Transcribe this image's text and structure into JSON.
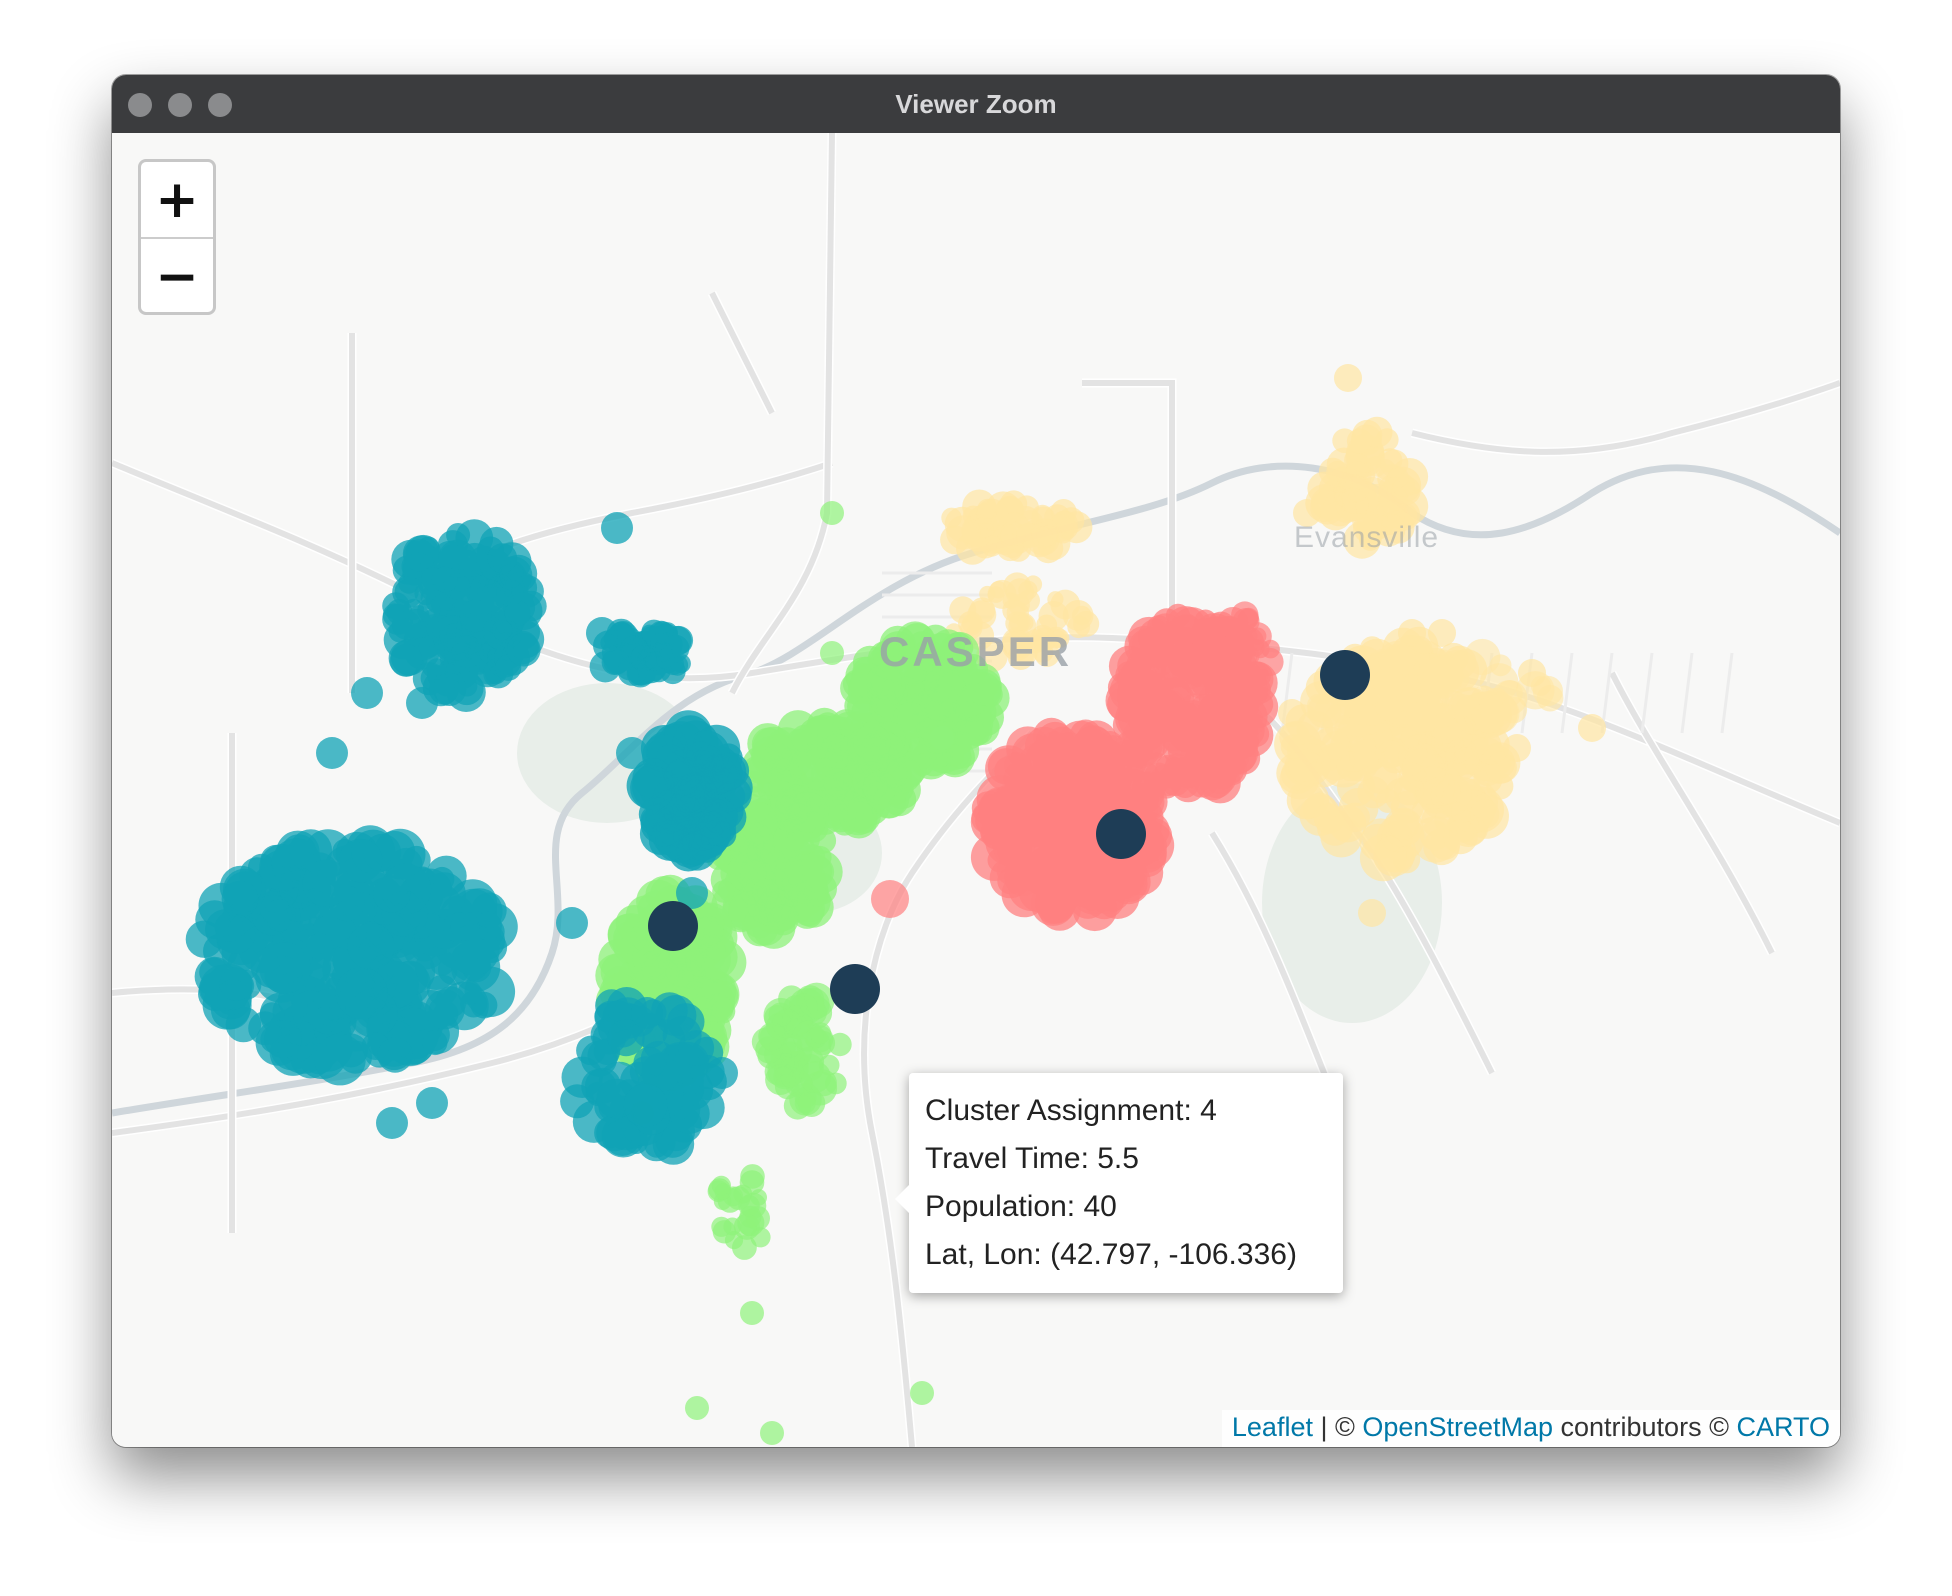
{
  "window": {
    "title": "Viewer Zoom"
  },
  "zoom": {
    "in_label": "+",
    "out_label": "−"
  },
  "places": [
    {
      "name": "CASPER"
    },
    {
      "name": "Evansville"
    }
  ],
  "tooltip": {
    "lines": [
      "Cluster Assignment: 4",
      "Travel Time: 5.5",
      "Population: 40",
      "Lat, Lon: (42.797, -106.336)"
    ]
  },
  "attribution": {
    "leaflet": "Leaflet",
    "sep1": " | © ",
    "osm": "OpenStreetMap",
    "contributors": " contributors © ",
    "carto": "CARTO"
  },
  "colors": {
    "cluster_teal": "#10a3b5",
    "cluster_green": "#8ef27a",
    "cluster_red": "#ff8080",
    "cluster_yellow": "#ffe6a3",
    "centroid": "#1e3d56",
    "road": "#e3e3e3",
    "river": "#cfd6db",
    "park": "#e8eee9"
  },
  "legend_clusters": [
    {
      "cluster": "teal"
    },
    {
      "cluster": "green"
    },
    {
      "cluster": "red"
    },
    {
      "cluster": "yellow"
    }
  ]
}
